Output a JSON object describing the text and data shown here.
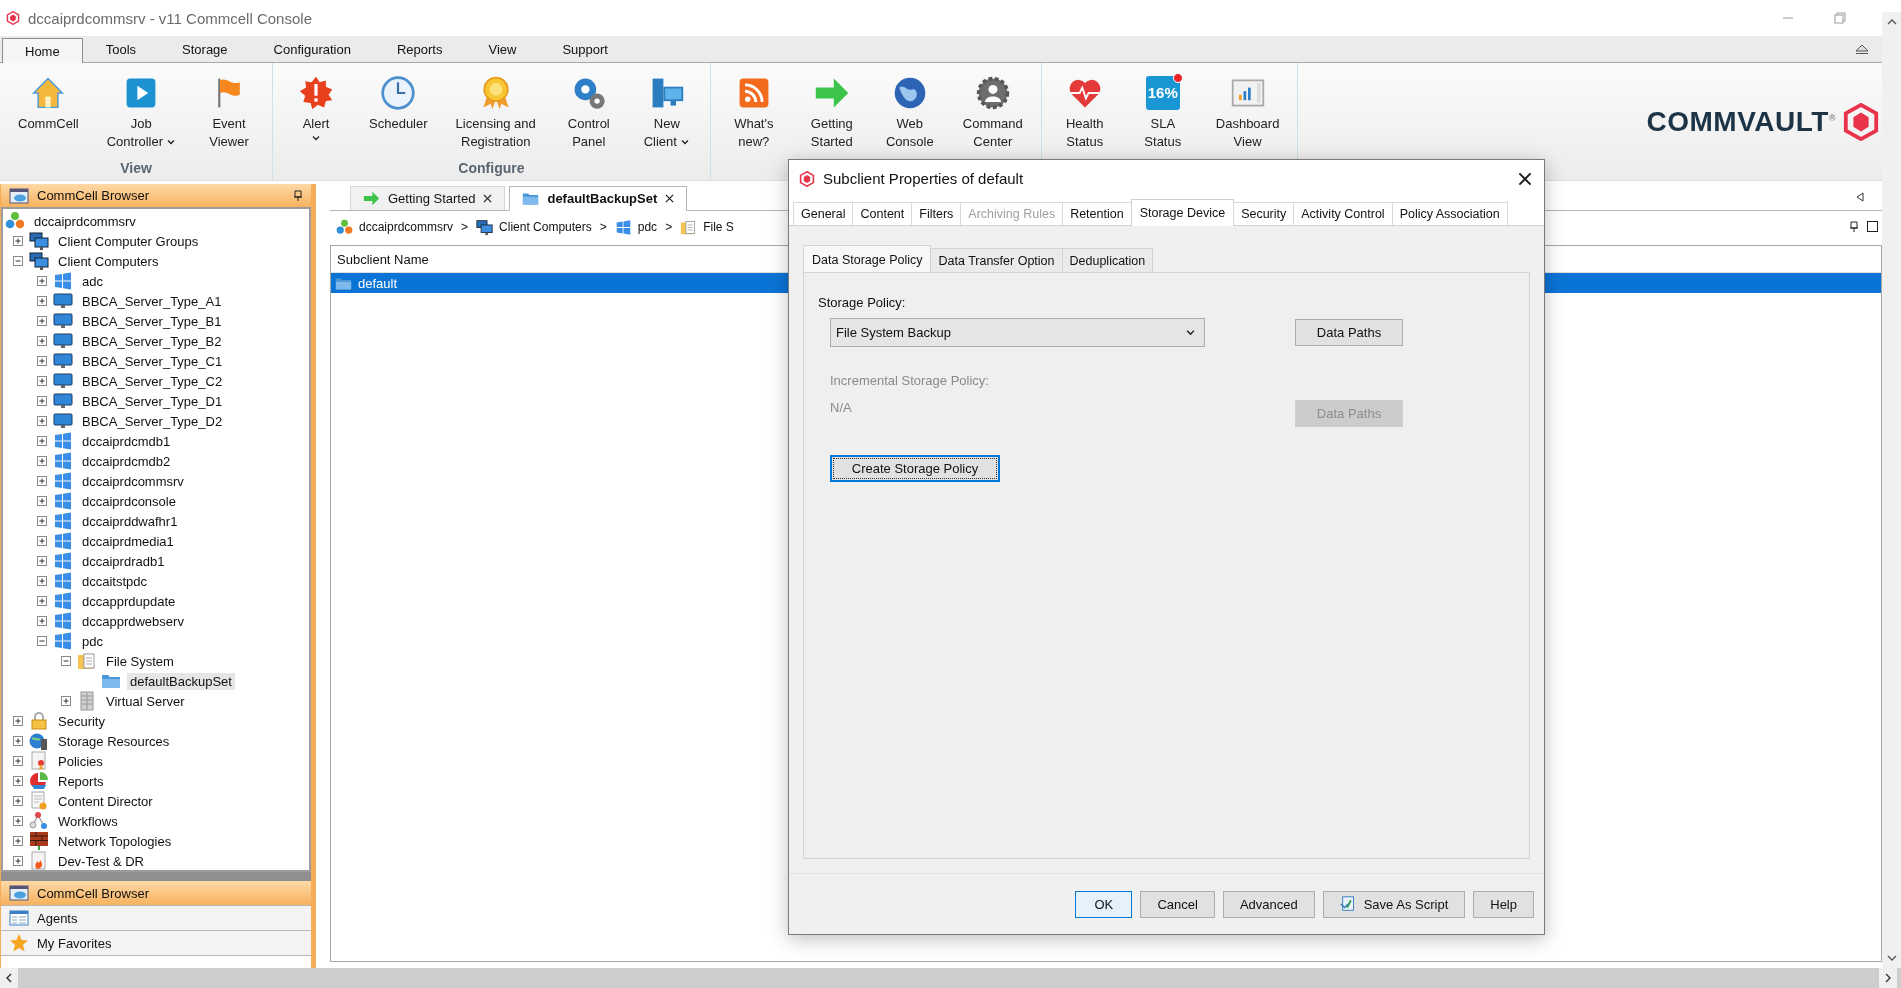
{
  "window": {
    "title": "dccaiprdcommsrv - v11 Commcell Console"
  },
  "menu_tabs": [
    {
      "label": "Home",
      "selected": true
    },
    {
      "label": "Tools",
      "selected": false
    },
    {
      "label": "Storage",
      "selected": false
    },
    {
      "label": "Configuration",
      "selected": false
    },
    {
      "label": "Reports",
      "selected": false
    },
    {
      "label": "View",
      "selected": false
    },
    {
      "label": "Support",
      "selected": false
    }
  ],
  "ribbon": {
    "groups": [
      {
        "label": "View",
        "buttons": [
          {
            "lines": [
              "CommCell"
            ],
            "kind": "home",
            "dropdown": false
          },
          {
            "lines": [
              "Job",
              "Controller"
            ],
            "kind": "play",
            "dropdown": true
          },
          {
            "lines": [
              "Event",
              "Viewer"
            ],
            "kind": "flag",
            "dropdown": false
          }
        ]
      },
      {
        "label": "Configure",
        "buttons": [
          {
            "lines": [
              "Alert"
            ],
            "kind": "alert",
            "dropdown": true
          },
          {
            "lines": [
              "Scheduler"
            ],
            "kind": "clock",
            "dropdown": false
          },
          {
            "lines": [
              "Licensing and",
              "Registration"
            ],
            "kind": "medal",
            "dropdown": false
          },
          {
            "lines": [
              "Control",
              "Panel"
            ],
            "kind": "gears",
            "dropdown": false
          },
          {
            "lines": [
              "New",
              "Client"
            ],
            "kind": "computer",
            "dropdown": true
          }
        ]
      },
      {
        "buttons": [
          {
            "lines": [
              "What's",
              "new?"
            ],
            "kind": "rss",
            "dropdown": false
          },
          {
            "lines": [
              "Getting",
              "Started"
            ],
            "kind": "arrow",
            "dropdown": false
          },
          {
            "lines": [
              "Web",
              "Console"
            ],
            "kind": "globe",
            "dropdown": false
          },
          {
            "lines": [
              "Command",
              "Center"
            ],
            "kind": "persongear",
            "dropdown": false
          }
        ]
      },
      {
        "buttons": [
          {
            "lines": [
              "Health",
              "Status"
            ],
            "kind": "heart",
            "dropdown": false
          },
          {
            "lines": [
              "SLA",
              "Status"
            ],
            "kind": "sla",
            "tile_text": "16%",
            "dropdown": false
          },
          {
            "lines": [
              "Dashboard",
              "View"
            ],
            "kind": "dashboard",
            "dropdown": false
          }
        ]
      }
    ],
    "logo": "COMMVAULT$^{®}$"
  },
  "browser_panel": {
    "title": "CommCell Browser",
    "tree": [
      {
        "label": "dccaiprdcommsrv",
        "kind": "commcell",
        "selected": false,
        "children": [
          {
            "label": "Client Computer Groups",
            "kind": "computers",
            "expanded": false,
            "selected": false
          },
          {
            "label": "Client Computers",
            "kind": "computers",
            "expanded": true,
            "selected": false,
            "children": [
              {
                "label": "adc",
                "kind": "windows",
                "expanded": false,
                "selected": false
              },
              {
                "label": "BBCA_Server_Type_A1",
                "kind": "monitor",
                "expanded": false,
                "selected": false
              },
              {
                "label": "BBCA_Server_Type_B1",
                "kind": "monitor",
                "expanded": false,
                "selected": false
              },
              {
                "label": "BBCA_Server_Type_B2",
                "kind": "monitor",
                "expanded": false,
                "selected": false
              },
              {
                "label": "BBCA_Server_Type_C1",
                "kind": "monitor",
                "expanded": false,
                "selected": false
              },
              {
                "label": "BBCA_Server_Type_C2",
                "kind": "monitor",
                "expanded": false,
                "selected": false
              },
              {
                "label": "BBCA_Server_Type_D1",
                "kind": "monitor",
                "expanded": false,
                "selected": false
              },
              {
                "label": "BBCA_Server_Type_D2",
                "kind": "monitor",
                "expanded": false,
                "selected": false
              },
              {
                "label": "dccaiprdcmdb1",
                "kind": "windows",
                "expanded": false,
                "selected": false
              },
              {
                "label": "dccaiprdcmdb2",
                "kind": "windows",
                "expanded": false,
                "selected": false
              },
              {
                "label": "dccaiprdcommsrv",
                "kind": "windows",
                "expanded": false,
                "selected": false
              },
              {
                "label": "dccaiprdconsole",
                "kind": "windows",
                "expanded": false,
                "selected": false
              },
              {
                "label": "dccaiprddwafhr1",
                "kind": "windows",
                "expanded": false,
                "selected": false
              },
              {
                "label": "dccaiprdmedia1",
                "kind": "windows",
                "expanded": false,
                "selected": false
              },
              {
                "label": "dccaiprdradb1",
                "kind": "windows",
                "expanded": false,
                "selected": false
              },
              {
                "label": "dccaitstpdc",
                "kind": "windows",
                "expanded": false,
                "selected": false
              },
              {
                "label": "dccapprdupdate",
                "kind": "windows",
                "expanded": false,
                "selected": false
              },
              {
                "label": "dccapprdwebserv",
                "kind": "windows",
                "expanded": false,
                "selected": false
              },
              {
                "label": "pdc",
                "kind": "windows",
                "expanded": true,
                "selected": false,
                "children": [
                  {
                    "label": "File System",
                    "kind": "filesystem",
                    "expanded": true,
                    "selected": false,
                    "children": [
                      {
                        "label": "defaultBackupSet",
                        "kind": "backupset",
                        "selected": true
                      }
                    ]
                  },
                  {
                    "label": "Virtual Server",
                    "kind": "rack",
                    "expanded": false,
                    "selected": false
                  }
                ]
              }
            ]
          },
          {
            "label": "Security",
            "kind": "lock",
            "expanded": false,
            "selected": false
          },
          {
            "label": "Storage Resources",
            "kind": "storage",
            "expanded": false,
            "selected": false
          },
          {
            "label": "Policies",
            "kind": "certificate",
            "expanded": false,
            "selected": false
          },
          {
            "label": "Reports",
            "kind": "pie",
            "expanded": false,
            "selected": false
          },
          {
            "label": "Content Director",
            "kind": "docgear",
            "expanded": false,
            "selected": false
          },
          {
            "label": "Workflows",
            "kind": "nodes",
            "expanded": false,
            "selected": false
          },
          {
            "label": "Network Topologies",
            "kind": "wall",
            "expanded": false,
            "selected": false
          },
          {
            "label": "Dev-Test & DR",
            "kind": "fire",
            "expanded": false,
            "selected": false
          }
        ]
      }
    ],
    "nav_items": [
      {
        "label": "CommCell Browser",
        "kind": "browser",
        "selected": true
      },
      {
        "label": "Agents",
        "kind": "agents",
        "selected": false
      },
      {
        "label": "My Favorites",
        "kind": "star",
        "selected": false
      }
    ]
  },
  "document_tabs": [
    {
      "label": "Getting Started",
      "kind": "arrow",
      "selected": false
    },
    {
      "label": "defaultBackupSet",
      "kind": "backupset",
      "selected": true
    }
  ],
  "breadcrumb": [
    {
      "label": "dccaiprdcommsrv",
      "kind": "commcell",
      "separator": ">"
    },
    {
      "label": "Client Computers",
      "kind": "computers",
      "separator": ">"
    },
    {
      "label": "pdc",
      "kind": "windows",
      "separator": ">"
    },
    {
      "label": "File S",
      "kind": "filesystem"
    }
  ],
  "table": {
    "columns": [
      "Subclient Name"
    ],
    "rows": [
      {
        "cells": [
          "default"
        ],
        "selected": true
      }
    ]
  },
  "dialog": {
    "title": "Subclient Properties of default",
    "tabs": [
      {
        "label": "General",
        "selected": false,
        "disabled": false
      },
      {
        "label": "Content",
        "selected": false,
        "disabled": false
      },
      {
        "label": "Filters",
        "selected": false,
        "disabled": false
      },
      {
        "label": "Archiving Rules",
        "selected": false,
        "disabled": true
      },
      {
        "label": "Retention",
        "selected": false,
        "disabled": false
      },
      {
        "label": "Storage Device",
        "selected": true,
        "disabled": false
      },
      {
        "label": "Security",
        "selected": false,
        "disabled": false
      },
      {
        "label": "Activity Control",
        "selected": false,
        "disabled": false
      },
      {
        "label": "Policy Association",
        "selected": false,
        "disabled": false
      }
    ],
    "subtabs": [
      {
        "label": "Data Storage Policy",
        "selected": true
      },
      {
        "label": "Data Transfer Option",
        "selected": false
      },
      {
        "label": "Deduplication",
        "selected": false
      }
    ],
    "storage_policy": {
      "label": "Storage Policy:",
      "value": "File System Backup",
      "button": {
        "label": "Data Paths",
        "disabled": false
      }
    },
    "incremental_policy": {
      "label": "Incremental Storage Policy:",
      "value": "N/A",
      "disabled": true,
      "button": {
        "label": "Data Paths",
        "disabled": true
      }
    },
    "create_button": {
      "label": "Create Storage Policy",
      "focused": true
    },
    "buttons": [
      {
        "label": "OK",
        "kind": "plain",
        "default": true
      },
      {
        "label": "Cancel",
        "kind": "plain",
        "default": false
      },
      {
        "label": "Advanced",
        "kind": "plain",
        "default": false
      },
      {
        "label": "Save As Script",
        "kind": "script",
        "default": false
      },
      {
        "label": "Help",
        "kind": "plain",
        "default": false
      }
    ]
  }
}
